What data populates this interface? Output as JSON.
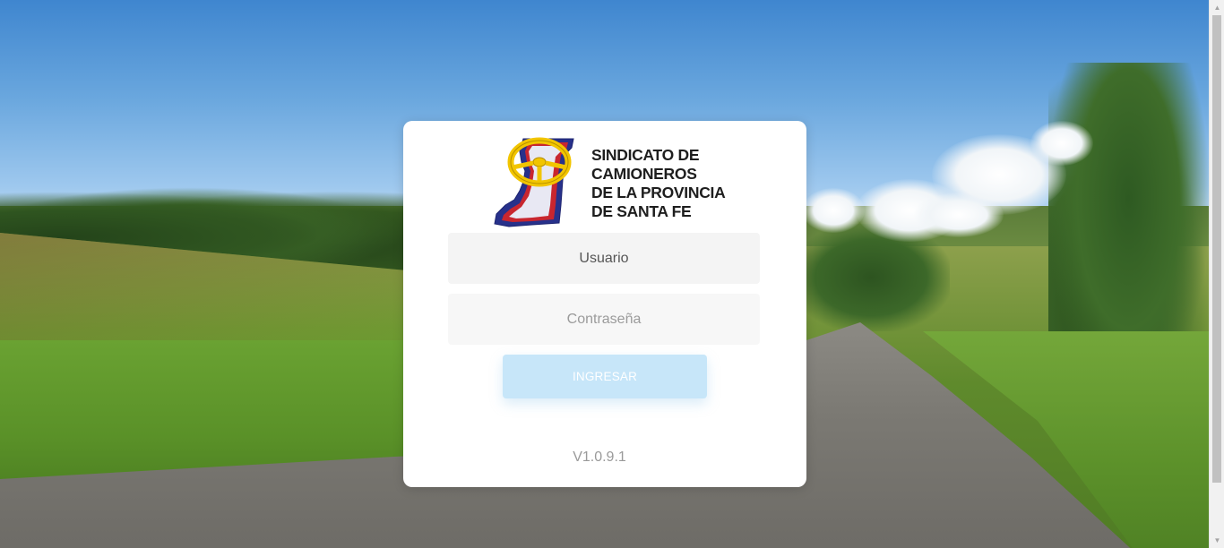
{
  "brand": {
    "logo_lines": [
      "SINDICATO DE",
      "CAMIONEROS",
      "DE LA PROVINCIA",
      "DE SANTA FE"
    ],
    "logo_icon": "steering-wheel-province-map-icon",
    "logo_colors": {
      "gold": "#f2c500",
      "blue": "#27318b",
      "red": "#c8262f"
    }
  },
  "login": {
    "username_placeholder": "Usuario",
    "password_placeholder": "Contraseña",
    "submit_label": "INGRESAR",
    "submit_color": "#c7e6f9"
  },
  "version": "V1.0.9.1",
  "scrollbar": {
    "up_arrow": "▲",
    "down_arrow": "▼"
  }
}
